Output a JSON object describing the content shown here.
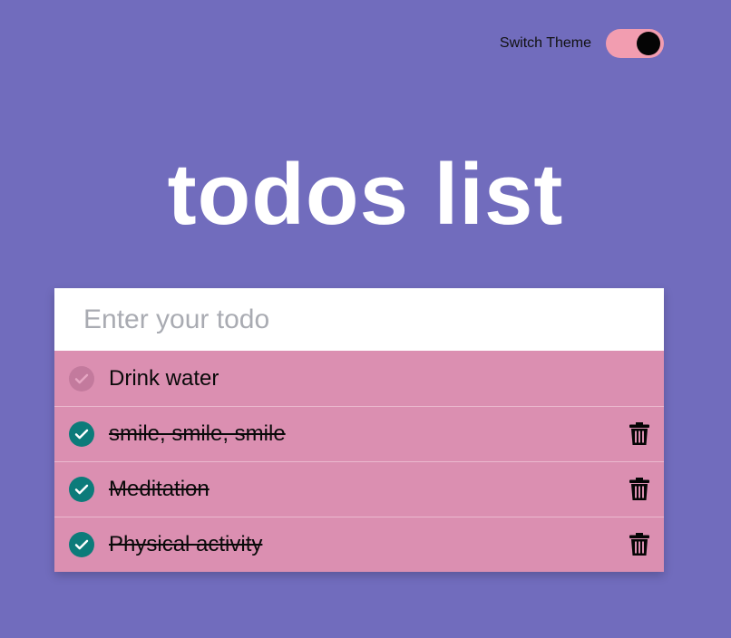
{
  "theme_switch": {
    "label": "Switch Theme",
    "state": "on",
    "track_color": "#f29db0",
    "knob_color": "#050505"
  },
  "title": "todos list",
  "input": {
    "placeholder": "Enter your todo",
    "value": ""
  },
  "todos": [
    {
      "text": "Drink water",
      "completed": false,
      "has_delete": false
    },
    {
      "text": "smile, smile, smile",
      "completed": true,
      "has_delete": true
    },
    {
      "text": "Meditation",
      "completed": true,
      "has_delete": true
    },
    {
      "text": "Physical activity",
      "completed": true,
      "has_delete": true
    }
  ],
  "colors": {
    "background": "#716cbd",
    "item_background": "#db8fb1",
    "check_done": "#0c7b7a",
    "check_pending": "#c37a9d",
    "icons": {
      "check": "check-icon",
      "delete": "trash-icon"
    }
  }
}
